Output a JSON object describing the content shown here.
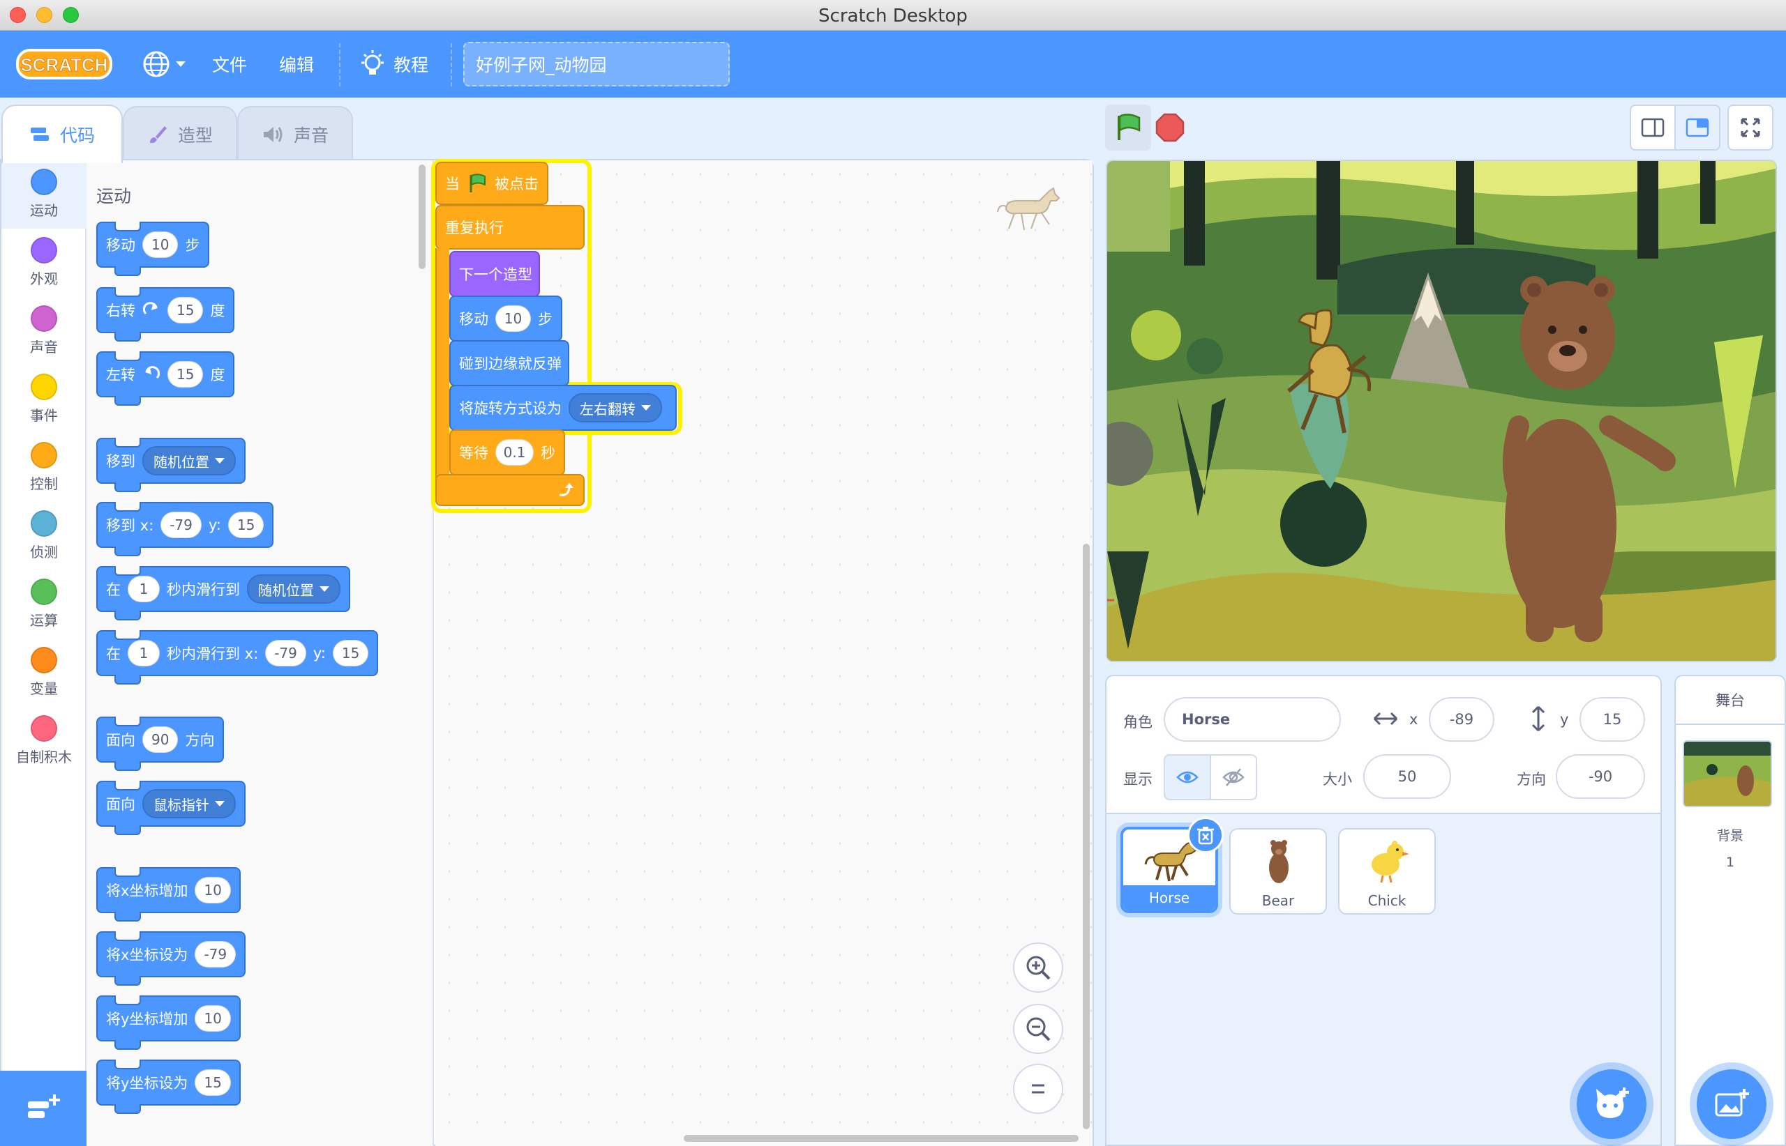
{
  "window": {
    "title": "Scratch Desktop"
  },
  "menubar": {
    "logo": "SCRATCH",
    "file": "文件",
    "edit": "编辑",
    "tutorials": "教程",
    "project_title": "好例子网_动物园"
  },
  "tabs": {
    "code": "代码",
    "costumes": "造型",
    "sounds": "声音"
  },
  "categories": [
    {
      "label": "运动",
      "color": "#4c97ff"
    },
    {
      "label": "外观",
      "color": "#9966ff"
    },
    {
      "label": "声音",
      "color": "#cf63cf"
    },
    {
      "label": "事件",
      "color": "#ffd500"
    },
    {
      "label": "控制",
      "color": "#ffab19"
    },
    {
      "label": "侦测",
      "color": "#5cb1d6"
    },
    {
      "label": "运算",
      "color": "#59c059"
    },
    {
      "label": "变量",
      "color": "#ff8c1a"
    },
    {
      "label": "自制积木",
      "color": "#ff6680"
    }
  ],
  "palette": {
    "title": "运动",
    "move": {
      "a": "移动",
      "v": "10",
      "b": "步"
    },
    "turn_right": {
      "a": "右转",
      "v": "15",
      "b": "度"
    },
    "turn_left": {
      "a": "左转",
      "v": "15",
      "b": "度"
    },
    "goto": {
      "a": "移到",
      "dd": "随机位置"
    },
    "goto_xy": {
      "a": "移到 x:",
      "x": "-79",
      "b": "y:",
      "y": "15"
    },
    "glide": {
      "a": "在",
      "v": "1",
      "b": "秒内滑行到",
      "dd": "随机位置"
    },
    "glide_xy": {
      "a": "在",
      "v": "1",
      "b": "秒内滑行到 x:",
      "x": "-79",
      "c": "y:",
      "y": "15"
    },
    "point_dir": {
      "a": "面向",
      "v": "90",
      "b": "方向"
    },
    "point_towards": {
      "a": "面向",
      "dd": "鼠标指针"
    },
    "change_x": {
      "a": "将x坐标增加",
      "v": "10"
    },
    "set_x": {
      "a": "将x坐标设为",
      "v": "-79"
    },
    "change_y": {
      "a": "将y坐标增加",
      "v": "10"
    },
    "set_y": {
      "a": "将y坐标设为",
      "v": "15"
    }
  },
  "script": {
    "hat_a": "当",
    "hat_b": "被点击",
    "forever": "重复执行",
    "next_costume": "下一个造型",
    "move": {
      "a": "移动",
      "v": "10",
      "b": "步"
    },
    "bounce": "碰到边缘就反弹",
    "rotation": {
      "a": "将旋转方式设为",
      "dd": "左右翻转"
    },
    "wait": {
      "a": "等待",
      "v": "0.1",
      "b": "秒"
    }
  },
  "sprite_info": {
    "sprite_label": "角色",
    "sprite_name": "Horse",
    "x_label": "x",
    "x": "-89",
    "y_label": "y",
    "y": "15",
    "show_label": "显示",
    "size_label": "大小",
    "size": "50",
    "direction_label": "方向",
    "direction": "-90"
  },
  "sprites": [
    {
      "name": "Horse"
    },
    {
      "name": "Bear"
    },
    {
      "name": "Chick"
    }
  ],
  "stage_panel": {
    "title": "舞台",
    "backdrops_label": "背景",
    "backdrops_count": "1"
  },
  "colors": {
    "accent": "#4c97ff",
    "motion": "#4c97ff",
    "control": "#ffab19",
    "looks": "#9966ff",
    "events": "#ffbf00",
    "glow": "#fff200"
  }
}
